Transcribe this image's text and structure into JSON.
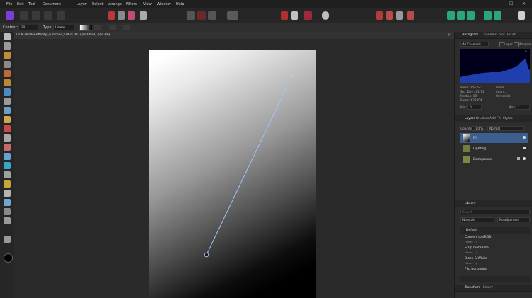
{
  "menu": {
    "items": [
      "File",
      "Edit",
      "Text",
      "Document",
      "Layer",
      "Select",
      "Arrange",
      "Filters",
      "View",
      "Window",
      "Help"
    ],
    "window_controls": [
      "—",
      "☐",
      "✕"
    ]
  },
  "context_bar": {
    "context_label": "Context:",
    "context_value": "Fill",
    "type_label": "Type:",
    "type_value": "Linear"
  },
  "document_tab": {
    "title": "DCM2870s&effinity_summer_START.JPG [Modified] (33.3%)"
  },
  "histogram_panel": {
    "tabs": [
      "Histogram",
      "Channels",
      "Color",
      "Brush"
    ],
    "channel_select": "All Channels",
    "layer_label": "Layer",
    "marquee_label": "Marquee",
    "warning_icon": "⚠",
    "stats_left": [
      "Mean: 156.54",
      "Std. Dev.: 81.71",
      "Median: 89",
      "Pixels: 622204"
    ],
    "stats_right": [
      "Level:",
      "Count:",
      "Percentile:"
    ],
    "min_label": "Min:",
    "min_value": "0",
    "max_label": "Max:",
    "max_value": "1"
  },
  "layers_panel": {
    "tabs": [
      "Layers",
      "Brushes",
      "Add",
      "FX",
      "Styles"
    ],
    "opacity_label": "Opacity:",
    "opacity_value": "100 %",
    "blend_mode": "Normal",
    "layers": [
      {
        "name": "Fill",
        "selected": true
      },
      {
        "name": "Lighting",
        "selected": false
      },
      {
        "name": "Background",
        "selected": false
      }
    ]
  },
  "library_panel": {
    "title": "Library",
    "search_placeholder": "Search",
    "scale_select": "No scale",
    "alignment_select": "No alignment",
    "category": "Default",
    "items": [
      {
        "label": "Convert to sRGB",
        "sub": "(Steps: 1)"
      },
      {
        "label": "Strip metadata",
        "sub": "(Steps: 1)"
      },
      {
        "label": "Black & White",
        "sub": "(Steps: 1)"
      },
      {
        "label": "Flip horizontal",
        "sub": ""
      }
    ]
  },
  "bottom_tabs": [
    "Transform",
    "History"
  ],
  "colors": {
    "accent_purple": "#7a3fd6",
    "selection_blue": "#3d5f8f",
    "gradient_handle": "#9ec6ff",
    "histogram_bg": "#00001a",
    "histogram_fill": "#1f3fae"
  }
}
